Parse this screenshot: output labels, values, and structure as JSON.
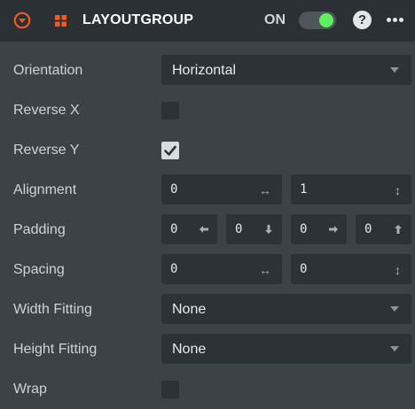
{
  "header": {
    "title": "LAYOUTGROUP",
    "on_label": "ON",
    "help_label": "?"
  },
  "colors": {
    "accent": "#f05a24",
    "toggle_on": "#5ff05f",
    "panel_bg": "#3b4346",
    "field_bg": "#2c3235"
  },
  "icons": {
    "collapse": "chevron-down-circle-icon",
    "component": "grid-icon",
    "help": "question-circle-icon",
    "more": "more-horizontal-icon"
  },
  "properties": {
    "orientation": {
      "label": "Orientation",
      "value": "Horizontal"
    },
    "reverse_x": {
      "label": "Reverse X",
      "checked": false
    },
    "reverse_y": {
      "label": "Reverse Y",
      "checked": true
    },
    "alignment": {
      "label": "Alignment",
      "x": "0",
      "y": "1"
    },
    "padding": {
      "label": "Padding",
      "left": "0",
      "bottom": "0",
      "right": "0",
      "top": "0"
    },
    "spacing": {
      "label": "Spacing",
      "x": "0",
      "y": "0"
    },
    "width_fitting": {
      "label": "Width Fitting",
      "value": "None"
    },
    "height_fitting": {
      "label": "Height Fitting",
      "value": "None"
    },
    "wrap": {
      "label": "Wrap",
      "checked": false
    }
  }
}
